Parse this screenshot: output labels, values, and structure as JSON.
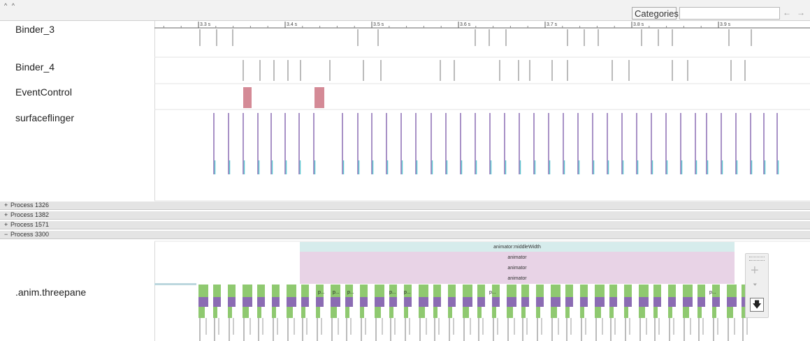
{
  "toolbar": {
    "collapse_glyph": "^ ^",
    "categories_label": "Categories",
    "categories_value": "",
    "prev_glyph": "←",
    "next_glyph": "→"
  },
  "ruler": {
    "ticks": [
      "3.3 s",
      "3.4 s",
      "3.5 s",
      "3.6 s",
      "3.7 s",
      "3.8 s",
      "3.9 s"
    ]
  },
  "tracks": [
    {
      "label": "Binder_3"
    },
    {
      "label": "Binder_4"
    },
    {
      "label": "EventControl"
    },
    {
      "label": "surfaceflinger"
    }
  ],
  "processes": [
    {
      "sign": "+",
      "label": "Process 1326"
    },
    {
      "sign": "+",
      "label": "Process 1382"
    },
    {
      "sign": "+",
      "label": "Process 1571"
    },
    {
      "sign": "−",
      "label": "Process 3300"
    }
  ],
  "thread": {
    "label": ".anim.threepane",
    "slices": [
      "animator:middleWidth",
      "animator",
      "animator",
      "animator"
    ],
    "short_slice_label": "p..."
  },
  "colors": {
    "event_slice": "#d48a96",
    "slice_teal": "#d6ecec",
    "slice_pink": "#e8d3e6",
    "green": "#8fc970",
    "purple": "#8b6cb3",
    "teal_tick": "#5cc7d0"
  },
  "zoom_tools": [
    "zoom-in",
    "select",
    "pan"
  ]
}
